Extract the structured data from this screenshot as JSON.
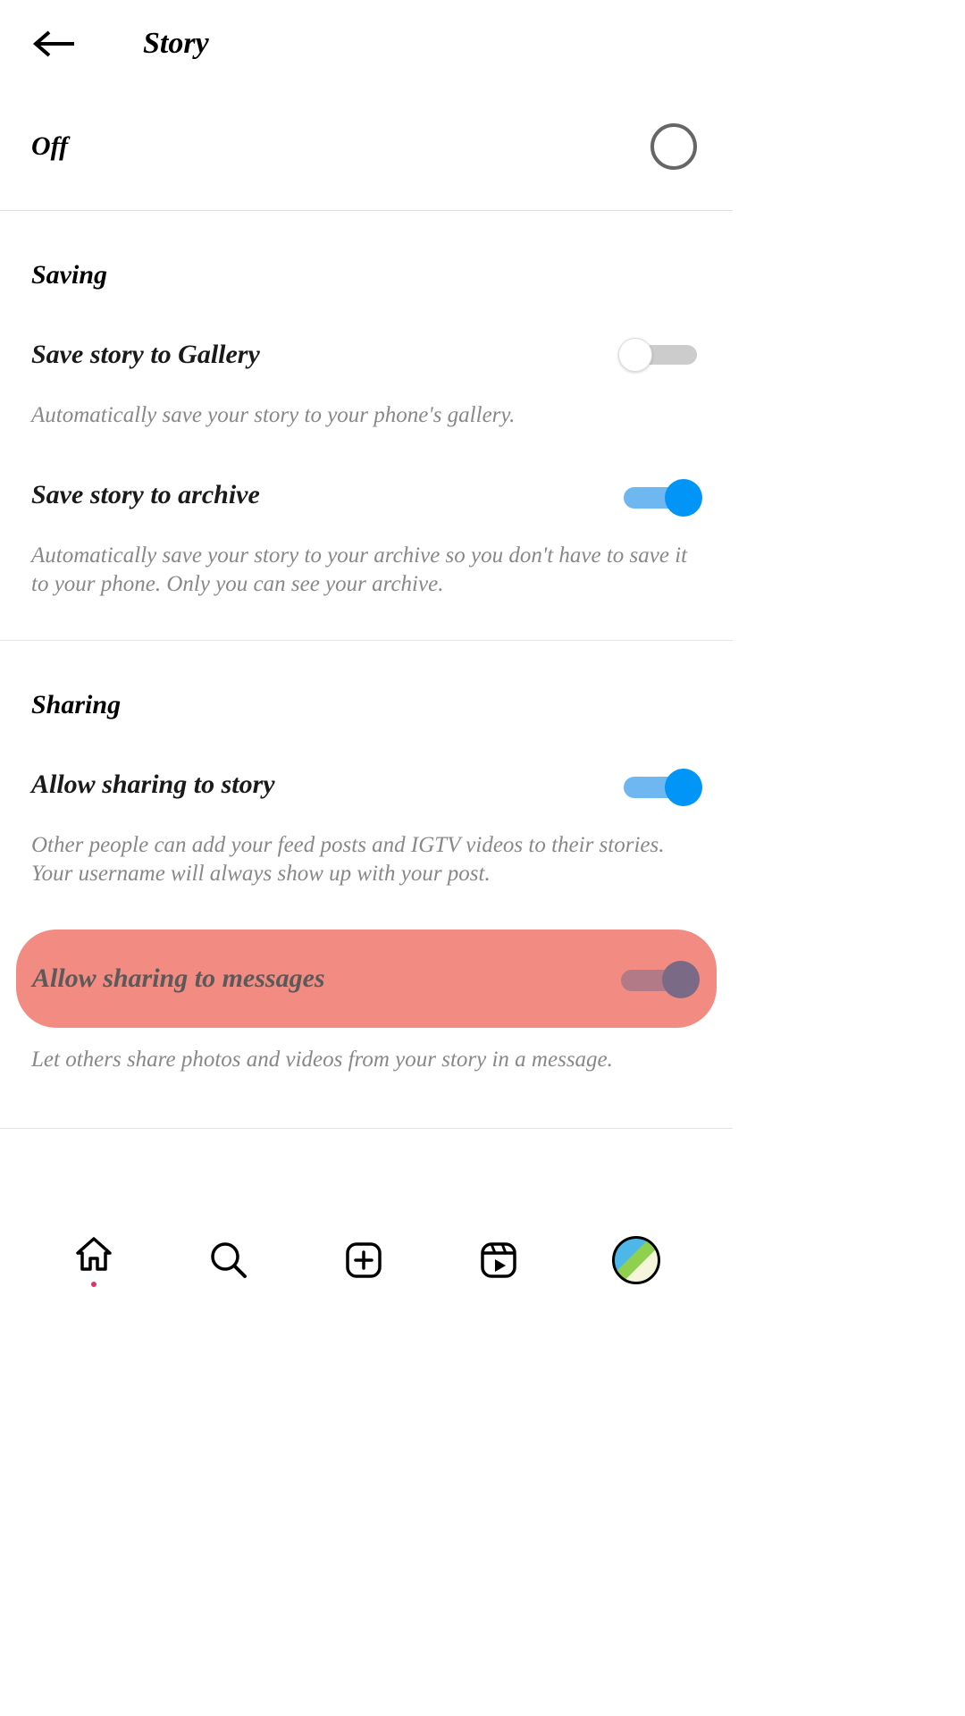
{
  "header": {
    "title": "Story"
  },
  "off_row": {
    "label": "Off"
  },
  "sections": {
    "saving": {
      "title": "Saving",
      "items": [
        {
          "label": "Save story to Gallery",
          "description": "Automatically save your story to your phone's gallery.",
          "enabled": false
        },
        {
          "label": "Save story to archive",
          "description": "Automatically save your story to your archive so you don't have to save it to your phone. Only you can see your archive.",
          "enabled": true
        }
      ]
    },
    "sharing": {
      "title": "Sharing",
      "items": [
        {
          "label": "Allow sharing to story",
          "description": "Other people can add your feed posts and IGTV videos to their stories. Your username will always show up with your post.",
          "enabled": true
        },
        {
          "label": "Allow sharing to messages",
          "description": "Let others share photos and videos from your story in a message.",
          "enabled": true,
          "highlighted": true
        }
      ]
    }
  },
  "nav": {
    "items": [
      "home",
      "search",
      "add",
      "reels",
      "profile"
    ]
  }
}
